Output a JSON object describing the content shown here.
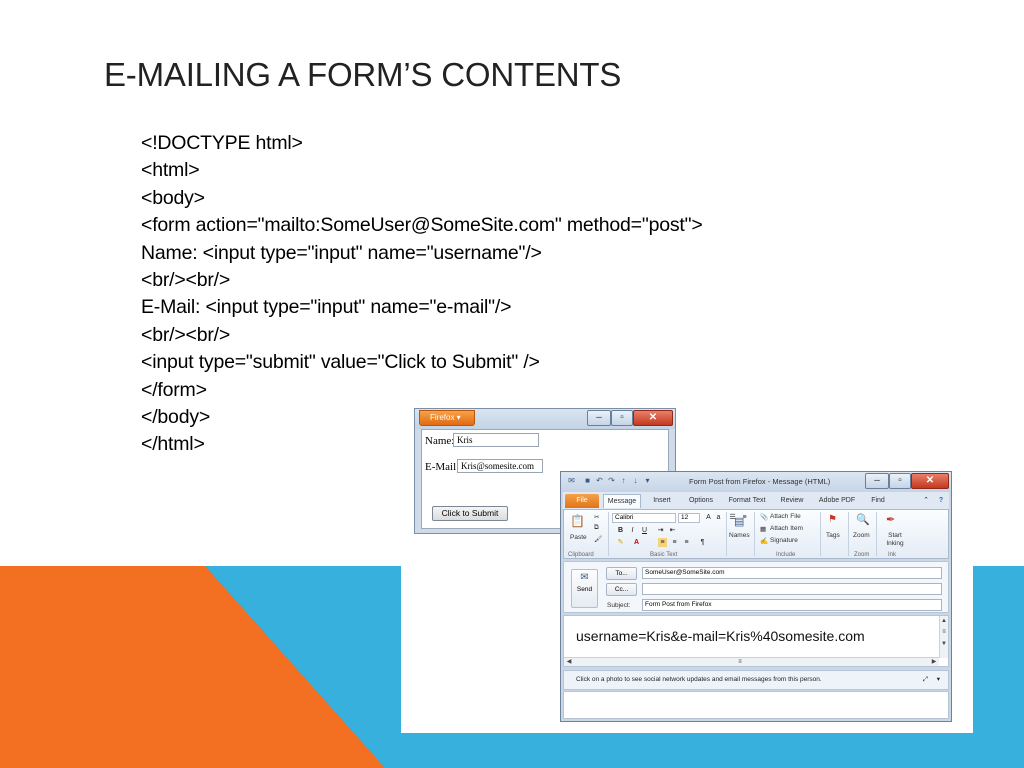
{
  "slide": {
    "title": "E-MAILING A FORM’S CONTENTS",
    "code_lines": [
      "<!DOCTYPE html>",
      "<html>",
      "<body>",
      "<form action=\"mailto:SomeUser@SomeSite.com\" method=\"post\">",
      "Name: <input type=\"input\" name=\"username\"/>",
      "<br/><br/>",
      "E-Mail: <input type=\"input\" name=\"e-mail\"/>",
      "<br/><br/>",
      "<input type=\"submit\" value=\"Click to Submit\" />",
      "</form>",
      "</body>",
      "</html>"
    ],
    "colors": {
      "orange": "#f36f21",
      "blue": "#38b0de",
      "dark_blue": "#3d8fb5"
    }
  },
  "firefox": {
    "menu_label": "Firefox",
    "name_label": "Name:",
    "name_value": "Kris",
    "email_label": "E-Mail:",
    "email_value": "Kris@somesite.com",
    "submit_label": "Click to Submit",
    "min_icon": "minimize-icon",
    "max_icon": "maximize-icon",
    "close_icon": "close-icon"
  },
  "outlook": {
    "title": "Form Post from Firefox - Message (HTML)",
    "tabs": [
      "File",
      "Message",
      "Insert",
      "Options",
      "Format Text",
      "Review",
      "Adobe PDF",
      "Find"
    ],
    "ribbon": {
      "paste": "Paste",
      "font": "Calibri",
      "size": "12",
      "names": "Names",
      "attach_file": "Attach File",
      "attach_item": "Attach Item",
      "signature": "Signature",
      "tags": "Tags",
      "zoom": "Zoom",
      "start_inking": "Start Inking",
      "groups": [
        "Clipboard",
        "Basic Text",
        "Include",
        "Zoom",
        "Ink"
      ]
    },
    "send_label": "Send",
    "to_button": "To...",
    "to_value": "SomeUser@SomeSite.com",
    "cc_button": "Cc...",
    "subject_label": "Subject:",
    "subject_value": "Form Post from Firefox",
    "body": "username=Kris&e-mail=Kris%40somesite.com",
    "people_pane": "Click on a photo to see social network updates and email messages from this person."
  }
}
